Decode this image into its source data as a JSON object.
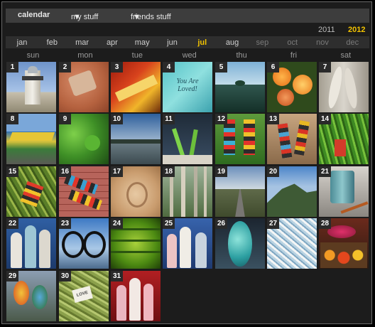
{
  "nav": {
    "calendar": "calendar",
    "my_stuff": "my stuff",
    "friends_stuff": "friends stuff"
  },
  "years": [
    "2011",
    "2012"
  ],
  "months": [
    "jan",
    "feb",
    "mar",
    "apr",
    "may",
    "jun",
    "jul",
    "aug",
    "sep",
    "oct",
    "nov",
    "dec"
  ],
  "current_month": "jul",
  "weekdays": [
    "sun",
    "mon",
    "tue",
    "wed",
    "thu",
    "fri",
    "sat"
  ],
  "days": [
    {
      "num": "1",
      "desc": "lighthouse"
    },
    {
      "num": "2",
      "desc": "stone on sand"
    },
    {
      "num": "3",
      "desc": "yellow ribbon"
    },
    {
      "num": "4",
      "desc": "you are loved note",
      "text": "You Are Loved!"
    },
    {
      "num": "5",
      "desc": "lake"
    },
    {
      "num": "6",
      "desc": "roses"
    },
    {
      "num": "7",
      "desc": "feathers"
    },
    {
      "num": "8",
      "desc": "graffiti wall"
    },
    {
      "num": "9",
      "desc": "green leaves"
    },
    {
      "num": "10",
      "desc": "seascape"
    },
    {
      "num": "11",
      "desc": "green shoots"
    },
    {
      "num": "12",
      "desc": "colorful boots"
    },
    {
      "num": "13",
      "desc": "boots red"
    },
    {
      "num": "14",
      "desc": "grass"
    },
    {
      "num": "15",
      "desc": "boot in grass"
    },
    {
      "num": "16",
      "desc": "boots on brick"
    },
    {
      "num": "17",
      "desc": "footprint sand"
    },
    {
      "num": "18",
      "desc": "forest"
    },
    {
      "num": "19",
      "desc": "road mountains"
    },
    {
      "num": "20",
      "desc": "mountain"
    },
    {
      "num": "21",
      "desc": "teal vase"
    },
    {
      "num": "22",
      "desc": "blue vases"
    },
    {
      "num": "23",
      "desc": "harbor fence"
    },
    {
      "num": "24",
      "desc": "green glass"
    },
    {
      "num": "25",
      "desc": "white vases"
    },
    {
      "num": "26",
      "desc": "teal vase closeup"
    },
    {
      "num": "27",
      "desc": "white flowers"
    },
    {
      "num": "28",
      "desc": "fruit and flowers"
    },
    {
      "num": "29",
      "desc": "parrots"
    },
    {
      "num": "30",
      "desc": "love tag on grass",
      "text": "LOVE"
    },
    {
      "num": "31",
      "desc": "pink vases red"
    }
  ]
}
